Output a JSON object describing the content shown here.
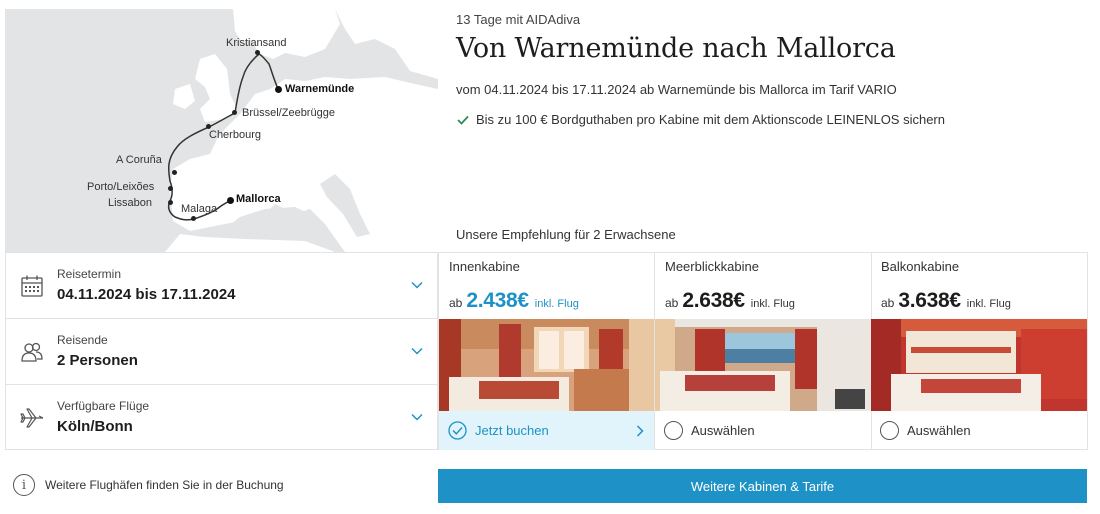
{
  "map": {
    "ports": [
      {
        "name": "Kristiansand",
        "bold": false
      },
      {
        "name": "Warnemünde",
        "bold": true
      },
      {
        "name": "Brüssel/Zeebrügge",
        "bold": false
      },
      {
        "name": "Cherbourg",
        "bold": false
      },
      {
        "name": "A Coruña",
        "bold": false
      },
      {
        "name": "Porto/Leixões",
        "bold": false
      },
      {
        "name": "Lissabon",
        "bold": false
      },
      {
        "name": "Malaga",
        "bold": false
      },
      {
        "name": "Mallorca",
        "bold": true
      }
    ]
  },
  "header": {
    "subtitle": "13 Tage mit AIDAdiva",
    "title": "Von Warnemünde nach Mallorca",
    "dates": "vom 04.11.2024 bis 17.11.2024 ab Warnemünde bis Mallorca im Tarif VARIO",
    "promo": "Bis zu 100 € Bordguthaben pro Kabine mit dem Aktionscode LEINENLOS sichern"
  },
  "recommendation": "Unsere Empfehlung für 2 Erwachsene",
  "selectors": [
    {
      "label": "Reisetermin",
      "value": "04.11.2024 bis 17.11.2024",
      "icon": "calendar-icon"
    },
    {
      "label": "Reisende",
      "value": "2 Personen",
      "icon": "persons-icon"
    },
    {
      "label": "Verfügbare Flüge",
      "value": "Köln/Bonn",
      "icon": "airplane-icon"
    }
  ],
  "info_text": "Weitere Flughäfen finden Sie in der Buchung",
  "cabins": [
    {
      "name": "Innenkabine",
      "prefix": "ab",
      "price": "2.438€",
      "suffix": "inkl. Flug",
      "action": "Jetzt buchen",
      "selected": true
    },
    {
      "name": "Meerblickkabine",
      "prefix": "ab",
      "price": "2.638€",
      "suffix": "inkl. Flug",
      "action": "Auswählen",
      "selected": false
    },
    {
      "name": "Balkonkabine",
      "prefix": "ab",
      "price": "3.638€",
      "suffix": "inkl. Flug",
      "action": "Auswählen",
      "selected": false
    }
  ],
  "more_button": "Weitere Kabinen & Tarife",
  "colors": {
    "accent": "#1e92c6",
    "accent_light": "#e1f3fb",
    "check": "#2e8b57",
    "map_land": "#ffffff",
    "map_sea": "#e3e4e6"
  }
}
